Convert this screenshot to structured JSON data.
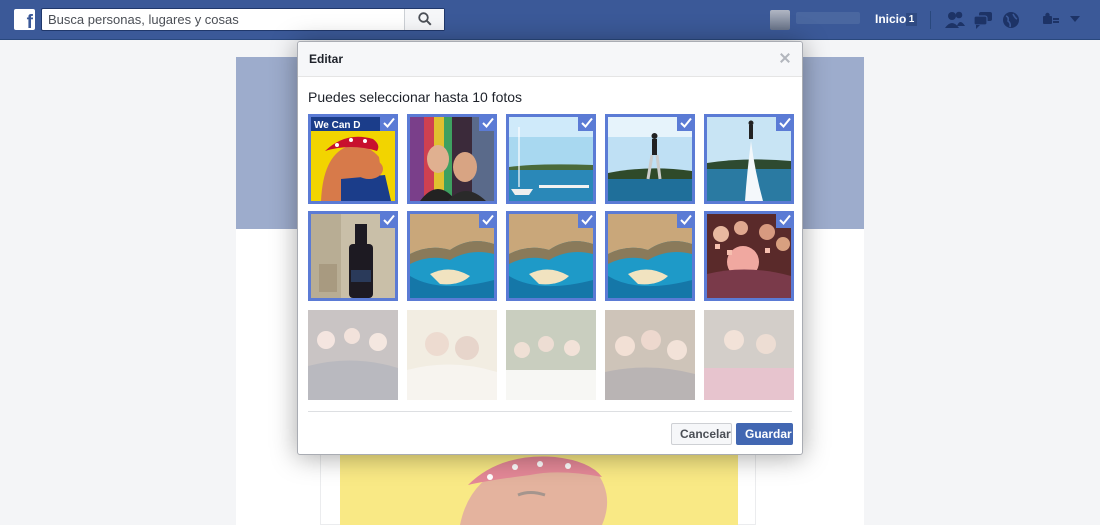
{
  "topbar": {
    "logo_letter": "f",
    "search_placeholder": "Busca personas, lugares y cosas",
    "home_label": "Inicio",
    "home_count": "1",
    "icons": [
      "friends-icon",
      "messages-icon",
      "globe-icon",
      "settings-icon"
    ]
  },
  "dialog": {
    "title": "Editar",
    "instruction": "Puedes seleccionar hasta 10 fotos",
    "cancel_label": "Cancelar",
    "save_label": "Guardar",
    "photos": [
      {
        "subject": "we-can-do-it-poster",
        "selected": true,
        "caption": "We Can D"
      },
      {
        "subject": "party-selfie",
        "selected": true
      },
      {
        "subject": "lake-marina",
        "selected": true
      },
      {
        "subject": "flyboard-lake",
        "selected": true
      },
      {
        "subject": "flyboard-spray",
        "selected": true
      },
      {
        "subject": "bottle",
        "selected": true
      },
      {
        "subject": "navagio-beach",
        "selected": true
      },
      {
        "subject": "navagio-beach",
        "selected": true
      },
      {
        "subject": "navagio-beach",
        "selected": true
      },
      {
        "subject": "group-party",
        "selected": true
      },
      {
        "subject": "group-dinner",
        "selected": false
      },
      {
        "subject": "friends-portrait",
        "selected": false
      },
      {
        "subject": "outdoor-dinner",
        "selected": false
      },
      {
        "subject": "group-selfie",
        "selected": false
      },
      {
        "subject": "table-meal",
        "selected": false
      }
    ]
  },
  "colors": {
    "brand": "#3b5998",
    "selection": "#5b7bd5",
    "save_button": "#4267b2"
  }
}
